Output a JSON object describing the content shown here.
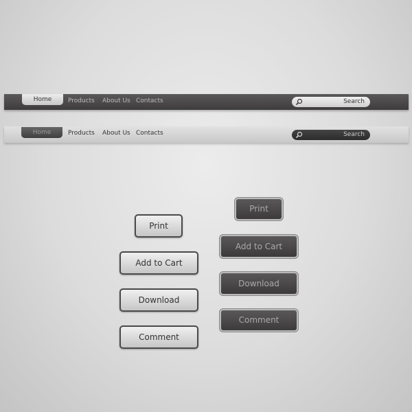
{
  "nav_dark": {
    "items": [
      "Home",
      "Products",
      "About Us",
      "Contacts"
    ],
    "search_label": "Search"
  },
  "nav_light": {
    "items": [
      "Home",
      "Products",
      "About Us",
      "Contacts"
    ],
    "search_label": "Search"
  },
  "buttons_light": [
    "Print",
    "Add to Cart",
    "Download",
    "Comment"
  ],
  "buttons_dark": [
    "Print",
    "Add to Cart",
    "Download",
    "Comment"
  ],
  "icons": {
    "search": "magnifier-icon"
  }
}
